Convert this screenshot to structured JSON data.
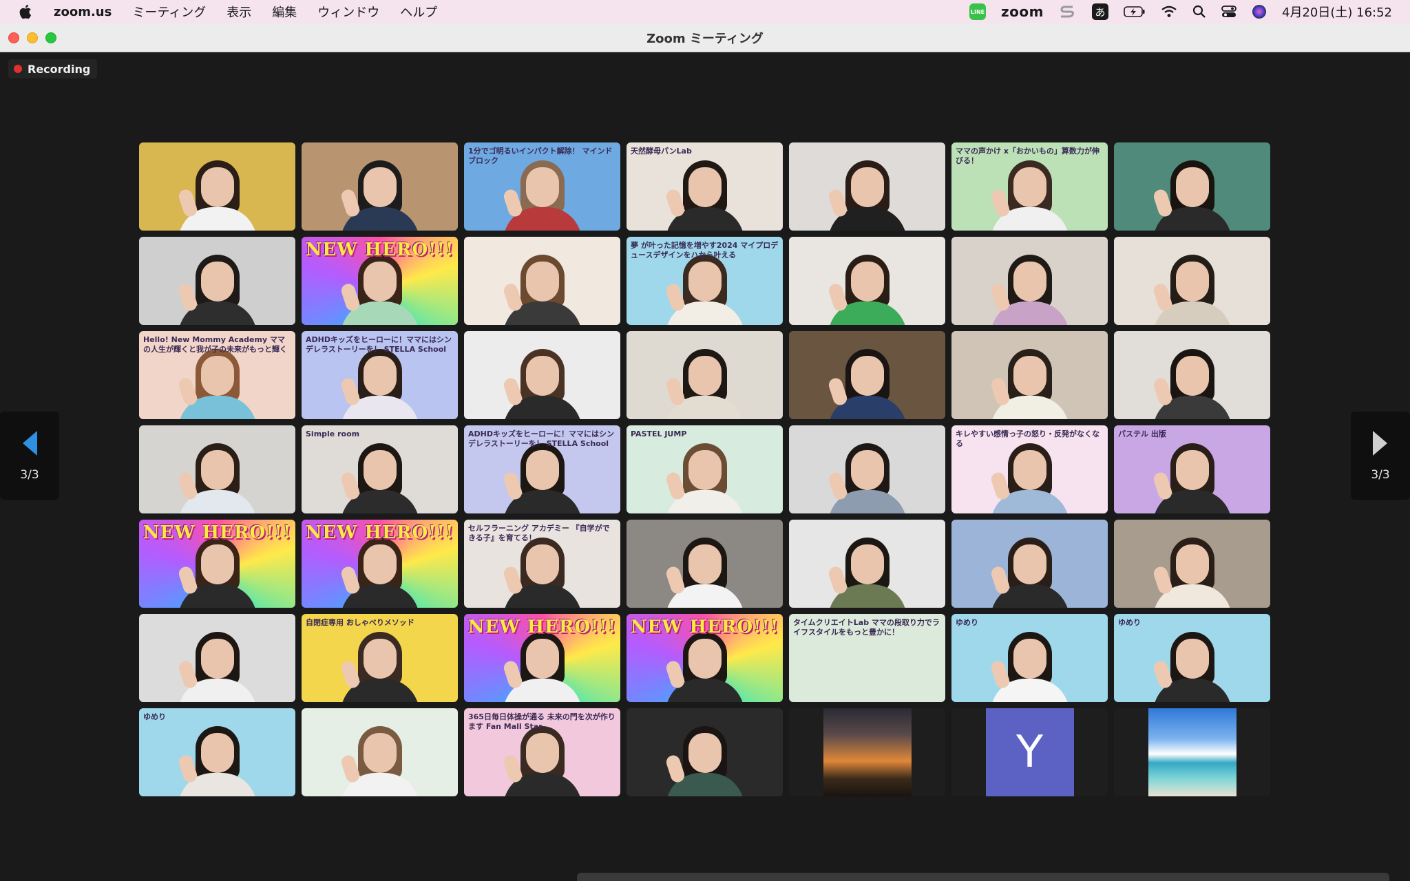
{
  "menubar": {
    "app_name": "zoom.us",
    "items": [
      "ミーティング",
      "表示",
      "編集",
      "ウィンドウ",
      "ヘルプ"
    ],
    "status": {
      "line_label": "LINE",
      "zoom_label": "zoom",
      "ime_label": "あ",
      "datetime": "4月20日(土)  16:52"
    }
  },
  "window": {
    "title": "Zoom ミーティング",
    "recording_label": "Recording"
  },
  "navigation": {
    "prev_page": "3/3",
    "next_page": "3/3"
  },
  "tiles": [
    {
      "bg": "#d8b650",
      "hair": "#2b1e16",
      "body": "#f2f2f2"
    },
    {
      "bg": "#b89570",
      "hair": "#1c1c1c",
      "body": "#2a3a55"
    },
    {
      "bg": "#6ea9e2",
      "hair": "#8a6b52",
      "body": "#b83a3a",
      "text": "1分でゴ明るいインパクト解除！ マインドブロック"
    },
    {
      "bg": "#e8e2da",
      "hair": "#201812",
      "body": "#2a2a2a",
      "text": "天然酵母パンLab"
    },
    {
      "bg": "#dedbd8",
      "hair": "#2a1d18",
      "body": "#202020"
    },
    {
      "bg": "#bde1b6",
      "hair": "#3a2a22",
      "body": "#f0f0f0",
      "text": "ママの声かけ x「おかいもの」算数力が伸びる！"
    },
    {
      "bg": "#4f8a7a",
      "hair": "#1a1410",
      "body": "#2a2a2a"
    },
    {
      "bg": "#cfcfcf",
      "hair": "#1e1a17",
      "body": "#2e2e2e"
    },
    {
      "bg": "#f06fb0",
      "hair": "#3a2418",
      "body": "#a7d8b8",
      "banner": "NEW HERO!!!"
    },
    {
      "bg": "#f1e8e0",
      "hair": "#6b4a30",
      "body": "#3a3a3a"
    },
    {
      "bg": "#9fd8ea",
      "hair": "#3a2a20",
      "body": "#f3eee5",
      "text": "夢 が叶った記憶を増やす2024 マイプロデュースデザインをハから叶える"
    },
    {
      "bg": "#e9e6e1",
      "hair": "#2a1d15",
      "body": "#3cab5a"
    },
    {
      "bg": "#d8d2ca",
      "hair": "#201a17",
      "body": "#c9a2c8"
    },
    {
      "bg": "#e6e0d8",
      "hair": "#241c16",
      "body": "#d6cdbf"
    },
    {
      "bg": "#f2d5c9",
      "hair": "#8a5a38",
      "body": "#78c1d8",
      "text": "Hello! New Mommy Academy ママの人生が輝くと我が子の未来がもっと輝く"
    },
    {
      "bg": "#b9c5f0",
      "hair": "#2a1e18",
      "body": "#e9e6f0",
      "text": "ADHDキッズをヒーローに！ママにはシンデレラストーリーを！ STELLA School"
    },
    {
      "bg": "#ececec",
      "hair": "#4a3324",
      "body": "#2a2a2a"
    },
    {
      "bg": "#dedad2",
      "hair": "#1e1814",
      "body": "#e3dcd0"
    },
    {
      "bg": "#6a5540",
      "hair": "#1a1512",
      "body": "#2a3e6a"
    },
    {
      "bg": "#cfc4b6",
      "hair": "#2a201a",
      "body": "#f1eee4"
    },
    {
      "bg": "#e1ddd8",
      "hair": "#1a1512",
      "body": "#3a3a3a"
    },
    {
      "bg": "#d6d4d0",
      "hair": "#2a1e17",
      "body": "#e3e8ee"
    },
    {
      "bg": "#dfdcd8",
      "hair": "#1d1714",
      "body": "#2c2c2c",
      "text": "Simple room"
    },
    {
      "bg": "#c4c8ee",
      "hair": "#1d1713",
      "body": "#2a2a2a",
      "text": "ADHDキッズをヒーローに！ママにはシンデレラストーリーを！ STELLA School"
    },
    {
      "bg": "#d7ecdf",
      "hair": "#6a4d34",
      "body": "#f0efe9",
      "text": "PASTEL JUMP"
    },
    {
      "bg": "#d9d9d9",
      "hair": "#1d1815",
      "body": "#8e9cb0"
    },
    {
      "bg": "#f6e3ef",
      "hair": "#2a1f18",
      "body": "#9fb9d8",
      "text": "キレやすい感情っ子の怒り・反発がなくなる"
    },
    {
      "bg": "#c9a7e5",
      "hair": "#2a1f18",
      "body": "#2a2a2a",
      "text": "パステル 出版"
    },
    {
      "bg": "#f06fb0",
      "hair": "#3a2418",
      "body": "#2a2a2a",
      "banner": "NEW HERO!!!"
    },
    {
      "bg": "#f06fb0",
      "hair": "#3a2418",
      "body": "#2a2a2a",
      "banner": "NEW HERO!!!"
    },
    {
      "bg": "#e8e3df",
      "hair": "#3a2a22",
      "body": "#2a2a2a",
      "text": "セルフラーニング アカデミー 『自学ができる子』を育てる！"
    },
    {
      "bg": "#8c8985",
      "hair": "#1d1714",
      "body": "#f3f3f3"
    },
    {
      "bg": "#e6e6e6",
      "hair": "#1d1714",
      "body": "#6b7a52"
    },
    {
      "bg": "#9bb4d8",
      "hair": "#2a1f18",
      "body": "#2a2a2a"
    },
    {
      "bg": "#a89c8f",
      "hair": "#2a1f18",
      "body": "#f0e8dc"
    },
    {
      "bg": "#dcdcdc",
      "hair": "#1d1714",
      "body": "#f0f0f0"
    },
    {
      "bg": "#f4d64c",
      "hair": "#3a2a22",
      "body": "#2a2a2a",
      "text": "自閉症専用 おしゃべりメソッド"
    },
    {
      "bg": "#f06fb0",
      "hair": "#1d1714",
      "body": "#f0f0f0",
      "banner": "NEW HERO!!!"
    },
    {
      "bg": "#f06fb0",
      "hair": "#1d1714",
      "body": "#2a2a2a",
      "banner": "NEW HERO!!!"
    },
    {
      "bg": "#dceadb",
      "text": "タイムクリエイトLab ママの段取り力でライフスタイルをもっと豊かに！",
      "empty": true
    },
    {
      "bg": "#9fd8ea",
      "hair": "#1d1714",
      "body": "#f5f5f5",
      "text": "ゆめり"
    },
    {
      "bg": "#9fd8ea",
      "hair": "#1d1714",
      "body": "#2a2a2a",
      "text": "ゆめり"
    },
    {
      "bg": "#9fd8ea",
      "hair": "#1d1714",
      "body": "#e9e6e1",
      "text": "ゆめり"
    },
    {
      "bg": "#e6efe6",
      "hair": "#7a5a40",
      "body": "#f2f2f2"
    },
    {
      "bg": "#f1c8dc",
      "hair": "#3a2a22",
      "body": "#2a2a2a",
      "text": "365日毎日体操が通る 未来の門を次が作ります Fan Mall Star"
    },
    {
      "bg": "#2a2a2a",
      "hair": "#1a1512",
      "body": "#3a5a50"
    },
    {
      "bg": "#1e1e1e",
      "photo": "sunset"
    },
    {
      "bg": "#1e1e1e",
      "avatar": "Y"
    },
    {
      "bg": "#1e1e1e",
      "photo": "sea"
    }
  ]
}
